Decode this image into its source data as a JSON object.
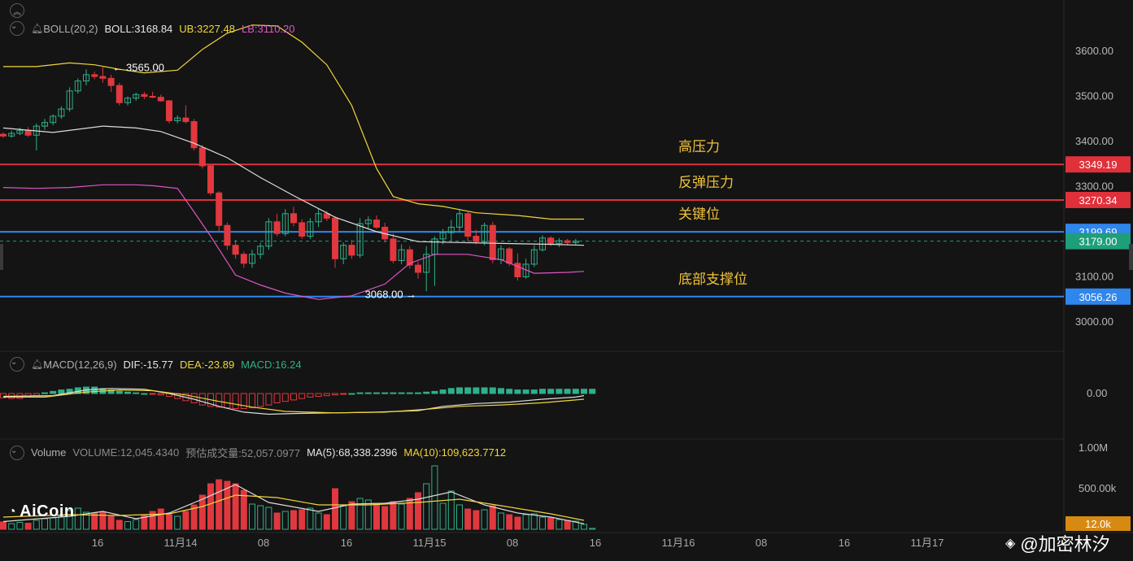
{
  "boll": {
    "name": "BOLL(20,2)",
    "mid": "BOLL:3168.84",
    "ub": "UB:3227.48",
    "lb": "LB:3110.20",
    "colors": {
      "mid": "#e6e6e6",
      "ub": "#f0d63c",
      "lb": "#e055c8"
    }
  },
  "macd": {
    "name": "MACD(12,26,9)",
    "dif": "DIF:-15.77",
    "dea": "DEA:-23.89",
    "macd": "MACD:16.24"
  },
  "volume": {
    "name": "Volume",
    "vol": "VOLUME:12,045.4340",
    "est": "预估成交量:52,057.0977",
    "ma5": "MA(5):68,338.2396",
    "ma10": "MA(10):109,623.7712"
  },
  "colors": {
    "up": "#2fb08a",
    "down": "#e0383e",
    "red_line": "#e0303a",
    "blue_line": "#2f86ec",
    "yellow": "#f0d63c",
    "pink": "#e055c8",
    "white": "#dcdcdc",
    "label_orange": "#d68a12",
    "label_text": "#f0c23a"
  },
  "brand": {
    "logo": "AiCoin",
    "watermark": "@加密林汐"
  },
  "chart_data": [
    {
      "type": "candlestick",
      "ylim": [
        2920,
        3660
      ],
      "y_ticks": [
        {
          "v": 3600,
          "label": "3600.00"
        },
        {
          "v": 3500,
          "label": "3500.00"
        },
        {
          "v": 3400,
          "label": "3400.00"
        },
        {
          "v": 3300,
          "label": "3300.00"
        },
        {
          "v": 3100,
          "label": "3100.00"
        },
        {
          "v": 3000,
          "label": "3000.00"
        }
      ],
      "x_ticks": [
        "16",
        "11月14",
        "08",
        "16",
        "11月15",
        "08",
        "16",
        "11月16",
        "08",
        "16",
        "11月17"
      ],
      "candles": [
        [
          3416,
          3420,
          3408,
          3412
        ],
        [
          3412,
          3424,
          3408,
          3418
        ],
        [
          3418,
          3430,
          3414,
          3424
        ],
        [
          3424,
          3432,
          3410,
          3414
        ],
        [
          3414,
          3440,
          3380,
          3434
        ],
        [
          3434,
          3450,
          3426,
          3442
        ],
        [
          3442,
          3460,
          3436,
          3456
        ],
        [
          3456,
          3478,
          3450,
          3472
        ],
        [
          3472,
          3520,
          3466,
          3512
        ],
        [
          3512,
          3540,
          3506,
          3534
        ],
        [
          3534,
          3560,
          3524,
          3548
        ],
        [
          3548,
          3555,
          3538,
          3544
        ],
        [
          3544,
          3565,
          3530,
          3540
        ],
        [
          3540,
          3548,
          3510,
          3524
        ],
        [
          3524,
          3530,
          3480,
          3486
        ],
        [
          3486,
          3500,
          3480,
          3496
        ],
        [
          3496,
          3508,
          3490,
          3504
        ],
        [
          3504,
          3510,
          3494,
          3500
        ],
        [
          3500,
          3510,
          3496,
          3498
        ],
        [
          3498,
          3504,
          3488,
          3490
        ],
        [
          3490,
          3492,
          3440,
          3446
        ],
        [
          3446,
          3458,
          3440,
          3452
        ],
        [
          3452,
          3480,
          3440,
          3444
        ],
        [
          3444,
          3450,
          3380,
          3386
        ],
        [
          3386,
          3392,
          3340,
          3346
        ],
        [
          3346,
          3350,
          3280,
          3286
        ],
        [
          3286,
          3290,
          3200,
          3214
        ],
        [
          3214,
          3220,
          3160,
          3170
        ],
        [
          3170,
          3182,
          3140,
          3150
        ],
        [
          3150,
          3156,
          3120,
          3130
        ],
        [
          3130,
          3160,
          3120,
          3150
        ],
        [
          3150,
          3176,
          3140,
          3168
        ],
        [
          3168,
          3230,
          3160,
          3222
        ],
        [
          3222,
          3240,
          3190,
          3196
        ],
        [
          3196,
          3250,
          3190,
          3240
        ],
        [
          3240,
          3255,
          3212,
          3220
        ],
        [
          3220,
          3228,
          3184,
          3190
        ],
        [
          3190,
          3230,
          3184,
          3222
        ],
        [
          3222,
          3250,
          3210,
          3240
        ],
        [
          3240,
          3246,
          3224,
          3230
        ],
        [
          3230,
          3234,
          3120,
          3140
        ],
        [
          3140,
          3176,
          3128,
          3170
        ],
        [
          3170,
          3182,
          3140,
          3148
        ],
        [
          3148,
          3230,
          3142,
          3218
        ],
        [
          3218,
          3234,
          3205,
          3226
        ],
        [
          3226,
          3236,
          3206,
          3210
        ],
        [
          3210,
          3220,
          3176,
          3184
        ],
        [
          3184,
          3196,
          3130,
          3136
        ],
        [
          3136,
          3172,
          3128,
          3160
        ],
        [
          3160,
          3168,
          3118,
          3126
        ],
        [
          3126,
          3134,
          3096,
          3110
        ],
        [
          3110,
          3168,
          3068,
          3150
        ],
        [
          3150,
          3190,
          3080,
          3184
        ],
        [
          3184,
          3206,
          3172,
          3198
        ],
        [
          3198,
          3226,
          3180,
          3210
        ],
        [
          3210,
          3250,
          3200,
          3240
        ],
        [
          3240,
          3244,
          3178,
          3190
        ],
        [
          3190,
          3204,
          3172,
          3178
        ],
        [
          3178,
          3220,
          3170,
          3214
        ],
        [
          3214,
          3222,
          3130,
          3138
        ],
        [
          3138,
          3170,
          3128,
          3162
        ],
        [
          3162,
          3166,
          3124,
          3130
        ],
        [
          3130,
          3152,
          3092,
          3100
        ],
        [
          3100,
          3140,
          3096,
          3128
        ],
        [
          3128,
          3170,
          3122,
          3160
        ],
        [
          3160,
          3192,
          3156,
          3186
        ],
        [
          3186,
          3190,
          3168,
          3174
        ],
        [
          3174,
          3186,
          3166,
          3180
        ],
        [
          3180,
          3184,
          3170,
          3176
        ],
        [
          3176,
          3184,
          3170,
          3179
        ]
      ],
      "boll_mid": [
        [
          0,
          3430
        ],
        [
          6,
          3420
        ],
        [
          12,
          3434
        ],
        [
          16,
          3430
        ],
        [
          19,
          3422
        ],
        [
          23,
          3396
        ],
        [
          27,
          3364
        ],
        [
          31,
          3320
        ],
        [
          35,
          3280
        ],
        [
          40,
          3232
        ],
        [
          45,
          3200
        ],
        [
          50,
          3178
        ],
        [
          55,
          3176
        ],
        [
          60,
          3174
        ],
        [
          66,
          3172
        ],
        [
          72,
          3170
        ]
      ],
      "boll_ub": [
        [
          0,
          3566
        ],
        [
          4,
          3566
        ],
        [
          8,
          3574
        ],
        [
          11,
          3570
        ],
        [
          14,
          3560
        ],
        [
          17,
          3552
        ],
        [
          21,
          3558
        ],
        [
          24,
          3604
        ],
        [
          27,
          3640
        ],
        [
          30,
          3658
        ],
        [
          33,
          3656
        ],
        [
          36,
          3620
        ],
        [
          39,
          3570
        ],
        [
          42,
          3480
        ],
        [
          45,
          3340
        ],
        [
          47,
          3278
        ],
        [
          50,
          3262
        ],
        [
          53,
          3256
        ],
        [
          57,
          3242
        ],
        [
          62,
          3236
        ],
        [
          66,
          3228
        ],
        [
          72,
          3228
        ]
      ],
      "boll_lb": [
        [
          0,
          3298
        ],
        [
          4,
          3296
        ],
        [
          8,
          3298
        ],
        [
          12,
          3304
        ],
        [
          16,
          3304
        ],
        [
          18,
          3302
        ],
        [
          21,
          3296
        ],
        [
          23,
          3244
        ],
        [
          25,
          3190
        ],
        [
          28,
          3104
        ],
        [
          31,
          3082
        ],
        [
          34,
          3064
        ],
        [
          38,
          3050
        ],
        [
          42,
          3058
        ],
        [
          46,
          3084
        ],
        [
          49,
          3130
        ],
        [
          52,
          3150
        ],
        [
          56,
          3150
        ],
        [
          60,
          3138
        ],
        [
          64,
          3108
        ],
        [
          68,
          3110
        ],
        [
          72,
          3112
        ]
      ],
      "levels": [
        {
          "value": 3349.19,
          "label": "3349.19",
          "name": "高压力",
          "color": "#e0303a",
          "label_color": "#e0303a"
        },
        {
          "value": 3270.34,
          "label": "3270.34",
          "name": "反弹压力",
          "color": "#e0303a",
          "label_color": "#e0303a"
        },
        {
          "value": 3199.69,
          "label": "3199.69",
          "name": "关键位",
          "color": "#2f86ec",
          "label_color": "#2f86ec"
        },
        {
          "value": 3056.26,
          "label": "3056.26",
          "name": "底部支撑位",
          "color": "#2f86ec",
          "label_color": "#2f86ec"
        }
      ],
      "last_price": {
        "value": 3179.0,
        "label": "3179.00",
        "color": "#1f9e7a"
      },
      "annotations": [
        {
          "text": "3565.00",
          "index": 12,
          "value": 3565,
          "arrow": "←",
          "side": "right"
        },
        {
          "text": "3068.00",
          "index": 51,
          "value": 3068,
          "arrow": "→",
          "side": "left"
        }
      ]
    },
    {
      "type": "bar",
      "name": "MACD",
      "ylim": [
        -30,
        18
      ],
      "y_ticks": [
        {
          "v": 0,
          "label": "0.00"
        }
      ],
      "hist": [
        -6,
        -7,
        -7,
        -5,
        -3,
        1,
        3,
        5,
        6,
        8,
        9,
        9,
        7,
        5,
        3,
        2,
        1,
        0,
        -1,
        -2,
        -4,
        -7,
        -10,
        -13,
        -16,
        -18,
        -19,
        -20,
        -21,
        -21,
        -20,
        -18,
        -16,
        -13,
        -11,
        -9,
        -7,
        -5,
        -4,
        -3,
        -2,
        -1,
        0,
        1,
        1,
        1,
        1,
        1,
        1,
        1,
        1,
        2,
        3,
        5,
        7,
        8,
        8,
        8,
        8,
        8,
        7,
        6,
        5,
        5,
        5,
        6,
        6,
        6,
        6,
        6,
        6,
        6
      ],
      "dif": [
        [
          0,
          -4
        ],
        [
          6,
          -3
        ],
        [
          10,
          5
        ],
        [
          13,
          7
        ],
        [
          17,
          6
        ],
        [
          20,
          0
        ],
        [
          23,
          -8
        ],
        [
          26,
          -18
        ],
        [
          29,
          -26
        ],
        [
          32,
          -29
        ],
        [
          35,
          -28
        ],
        [
          40,
          -27
        ],
        [
          45,
          -26
        ],
        [
          50,
          -24
        ],
        [
          53,
          -18
        ],
        [
          57,
          -14
        ],
        [
          61,
          -12
        ],
        [
          65,
          -8
        ],
        [
          69,
          -5
        ],
        [
          72,
          -3
        ]
      ],
      "dea": [
        [
          0,
          -5
        ],
        [
          5,
          -5
        ],
        [
          10,
          2
        ],
        [
          14,
          5
        ],
        [
          18,
          4
        ],
        [
          22,
          -2
        ],
        [
          26,
          -11
        ],
        [
          30,
          -19
        ],
        [
          34,
          -25
        ],
        [
          40,
          -27
        ],
        [
          46,
          -26
        ],
        [
          51,
          -22
        ],
        [
          55,
          -18
        ],
        [
          60,
          -16
        ],
        [
          65,
          -13
        ],
        [
          72,
          -8
        ]
      ]
    },
    {
      "type": "bar",
      "name": "Volume",
      "ylim": [
        0,
        1100000
      ],
      "y_ticks": [
        {
          "v": 1000000,
          "label": "1.00M"
        },
        {
          "v": 500000,
          "label": "500.00k"
        }
      ],
      "current_label": "12.0k",
      "values": [
        90000,
        70000,
        85000,
        75000,
        110000,
        130000,
        140000,
        160000,
        230000,
        260000,
        210000,
        200000,
        210000,
        160000,
        110000,
        95000,
        120000,
        180000,
        220000,
        250000,
        180000,
        160000,
        220000,
        300000,
        420000,
        560000,
        610000,
        590000,
        560000,
        480000,
        310000,
        290000,
        270000,
        200000,
        220000,
        230000,
        240000,
        260000,
        200000,
        180000,
        500000,
        290000,
        340000,
        380000,
        360000,
        310000,
        280000,
        340000,
        310000,
        380000,
        450000,
        560000,
        780000,
        320000,
        470000,
        300000,
        250000,
        230000,
        240000,
        290000,
        200000,
        180000,
        150000,
        180000,
        190000,
        150000,
        140000,
        120000,
        110000,
        100000,
        60000,
        12000
      ],
      "ma5": [
        [
          0,
          95000
        ],
        [
          8,
          160000
        ],
        [
          12,
          220000
        ],
        [
          16,
          130000
        ],
        [
          20,
          200000
        ],
        [
          24,
          370000
        ],
        [
          28,
          550000
        ],
        [
          32,
          330000
        ],
        [
          38,
          220000
        ],
        [
          42,
          310000
        ],
        [
          46,
          320000
        ],
        [
          50,
          370000
        ],
        [
          54,
          460000
        ],
        [
          58,
          300000
        ],
        [
          62,
          200000
        ],
        [
          66,
          150000
        ],
        [
          72,
          68000
        ]
      ],
      "ma10": [
        [
          0,
          150000
        ],
        [
          8,
          180000
        ],
        [
          14,
          170000
        ],
        [
          20,
          190000
        ],
        [
          24,
          280000
        ],
        [
          28,
          420000
        ],
        [
          33,
          390000
        ],
        [
          38,
          300000
        ],
        [
          44,
          300000
        ],
        [
          50,
          330000
        ],
        [
          55,
          370000
        ],
        [
          60,
          290000
        ],
        [
          66,
          190000
        ],
        [
          72,
          110000
        ]
      ]
    }
  ]
}
